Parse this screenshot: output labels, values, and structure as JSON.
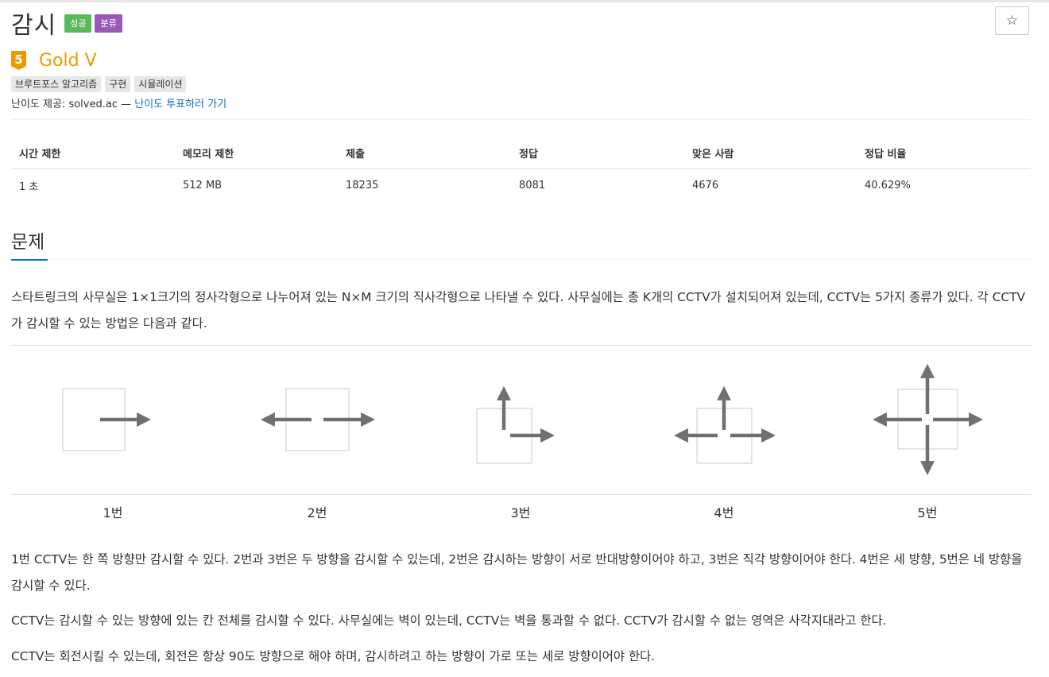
{
  "problem": {
    "title": "감시",
    "labels": [
      {
        "text": "성공",
        "color": "#5cb85c"
      },
      {
        "text": "분류",
        "color": "#9b59b6"
      }
    ],
    "star_icon": "star-outline-icon",
    "tier": {
      "badge": "5",
      "text": "Gold V",
      "color": "#ec9a00"
    },
    "tags": [
      "브루트포스 알고리즘",
      "구현",
      "시뮬레이션"
    ],
    "source": {
      "prefix": "난이도 제공: solved.ac — ",
      "link": "난이도 투표하러 가기",
      "link_color": "#0b6bbd"
    }
  },
  "info_table": {
    "headers": [
      "시간 제한",
      "메모리 제한",
      "제출",
      "정답",
      "맞은 사람",
      "정답 비율"
    ],
    "row": [
      "1 초",
      "512 MB",
      "18235",
      "8081",
      "4676",
      "40.629%"
    ]
  },
  "section": {
    "heading": "문제",
    "intro": "스타트링크의 사무실은 1×1크기의 정사각형으로 나누어져 있는 N×M 크기의 직사각형으로 나타낼 수 있다. 사무실에는 총 K개의 CCTV가 설치되어져 있는데, CCTV는 5가지 종류가 있다. 각 CCTV가 감시할 수 있는 방법은 다음과 같다.",
    "figure_captions": [
      "1번",
      "2번",
      "3번",
      "4번",
      "5번"
    ],
    "paragraphs": [
      "1번 CCTV는 한 쪽 방향만 감시할 수 있다. 2번과 3번은 두 방향을 감시할 수 있는데, 2번은 감시하는 방향이 서로 반대방향이어야 하고, 3번은 직각 방향이어야 한다. 4번은 세 방향, 5번은 네 방향을 감시할 수 있다.",
      "CCTV는 감시할 수 있는 방향에 있는 칸 전체를 감시할 수 있다. 사무실에는 벽이 있는데, CCTV는 벽을 통과할 수 없다. CCTV가 감시할 수 없는 영역은 사각지대라고 한다.",
      "CCTV는 회전시킬 수 있는데, 회전은 항상 90도 방향으로 해야 하며, 감시하려고 하는 방향이 가로 또는 세로 방향이어야 한다."
    ]
  }
}
